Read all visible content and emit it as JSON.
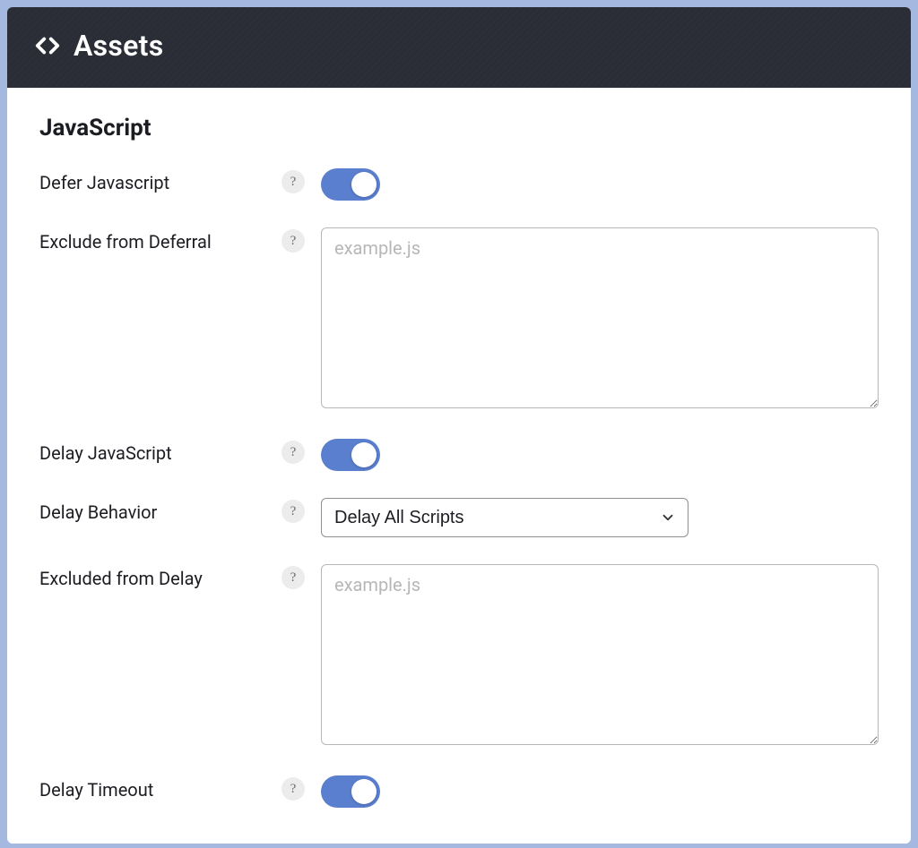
{
  "panel": {
    "title": "Assets"
  },
  "section": {
    "heading": "JavaScript"
  },
  "rows": {
    "defer_js": {
      "label": "Defer Javascript",
      "enabled": true
    },
    "exclude_deferral": {
      "label": "Exclude from Deferral",
      "placeholder": "example.js",
      "value": ""
    },
    "delay_js": {
      "label": "Delay JavaScript",
      "enabled": true
    },
    "delay_behavior": {
      "label": "Delay Behavior",
      "selected": "Delay All Scripts"
    },
    "excluded_delay": {
      "label": "Excluded from Delay",
      "placeholder": "example.js",
      "value": ""
    },
    "delay_timeout": {
      "label": "Delay Timeout",
      "enabled": true
    }
  },
  "help_glyph": "?"
}
